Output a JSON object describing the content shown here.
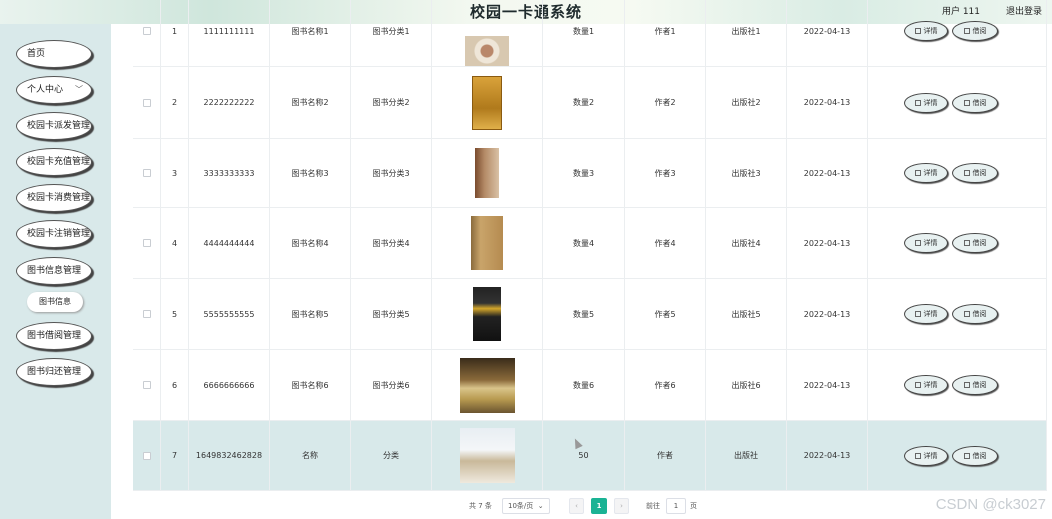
{
  "app": {
    "title": "校园一卡通系统",
    "user_label": "用户 111",
    "logout_label": "退出登录"
  },
  "sidebar": {
    "items": [
      {
        "label": "首页",
        "name": "home"
      },
      {
        "label": "个人中心",
        "name": "personal-center",
        "has_arrow": true
      },
      {
        "label": "校园卡派发管理",
        "name": "card-issue"
      },
      {
        "label": "校园卡充值管理",
        "name": "card-recharge"
      },
      {
        "label": "校园卡消费管理",
        "name": "card-consume"
      },
      {
        "label": "校园卡注销管理",
        "name": "card-cancel"
      },
      {
        "label": "图书信息管理",
        "name": "book-info"
      },
      {
        "label": "图书借阅管理",
        "name": "book-borrow"
      },
      {
        "label": "图书归还管理",
        "name": "book-return"
      }
    ],
    "submenu": {
      "label": "图书信息"
    }
  },
  "table": {
    "rows": [
      {
        "idx": "1",
        "code": "1111111111",
        "name": "图书名称1",
        "category": "图书分类1",
        "qty": "数量1",
        "author": "作者1",
        "publisher": "出版社1",
        "date": "2022-04-13",
        "cover": "plate"
      },
      {
        "idx": "2",
        "code": "2222222222",
        "name": "图书名称2",
        "category": "图书分类2",
        "qty": "数量2",
        "author": "作者2",
        "publisher": "出版社2",
        "date": "2022-04-13",
        "cover": "gold"
      },
      {
        "idx": "3",
        "code": "3333333333",
        "name": "图书名称3",
        "category": "图书分类3",
        "qty": "数量3",
        "author": "作者3",
        "publisher": "出版社3",
        "date": "2022-04-13",
        "cover": "brown"
      },
      {
        "idx": "4",
        "code": "4444444444",
        "name": "图书名称4",
        "category": "图书分类4",
        "qty": "数量4",
        "author": "作者4",
        "publisher": "出版社4",
        "date": "2022-04-13",
        "cover": "tan"
      },
      {
        "idx": "5",
        "code": "5555555555",
        "name": "图书名称5",
        "category": "图书分类5",
        "qty": "数量5",
        "author": "作者5",
        "publisher": "出版社5",
        "date": "2022-04-13",
        "cover": "dark"
      },
      {
        "idx": "6",
        "code": "6666666666",
        "name": "图书名称6",
        "category": "图书分类6",
        "qty": "数量6",
        "author": "作者6",
        "publisher": "出版社6",
        "date": "2022-04-13",
        "cover": "openbook"
      },
      {
        "idx": "7",
        "code": "1649832462828",
        "name": "名称",
        "category": "分类",
        "qty": "50",
        "author": "作者",
        "publisher": "出版社",
        "date": "2022-04-13",
        "cover": "pages"
      }
    ],
    "detail_label": "详情",
    "borrow_label": "借阅"
  },
  "pagination": {
    "total": "共 7 条",
    "page_size": "10条/页",
    "current": "1",
    "goto_label": "前往",
    "goto_value": "1",
    "page_suffix": "页"
  },
  "watermark": "CSDN @ck3027",
  "colors": {
    "accent": "#1ab394",
    "highlight_row": "#d8e9ea",
    "sidebar_bg": "#d9e9ea"
  }
}
